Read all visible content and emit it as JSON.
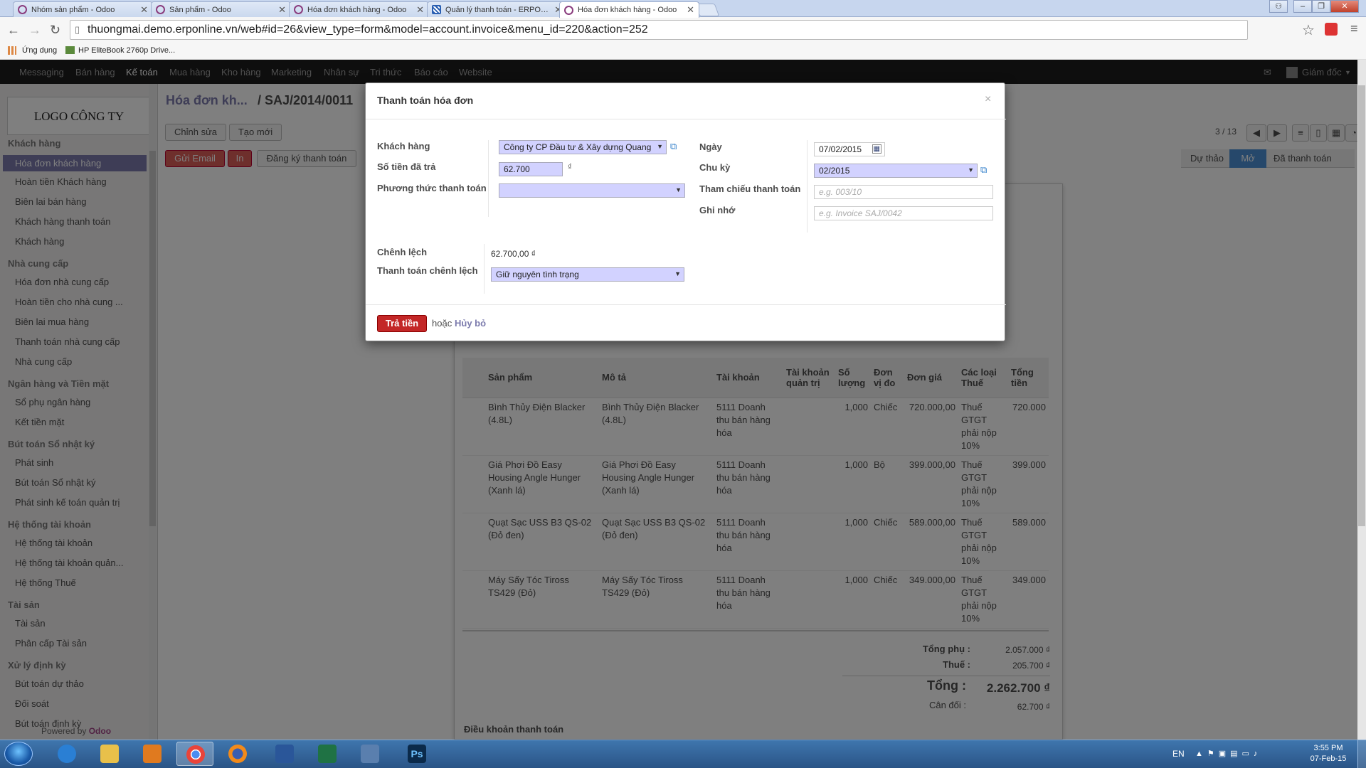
{
  "browser": {
    "tabs": [
      {
        "title": "Nhóm sản phẩm - Odoo",
        "icon": "odoo-icon"
      },
      {
        "title": "Sản phẩm - Odoo",
        "icon": "odoo-icon"
      },
      {
        "title": "Hóa đơn khách hàng - Odoo",
        "icon": "odoo-icon"
      },
      {
        "title": "Quản lý thanh toán - ERPOnlin",
        "icon": "erp-icon"
      },
      {
        "title": "Hóa đơn khách hàng - Odoo",
        "icon": "odoo-icon"
      }
    ],
    "url": "thuongmai.demo.erponline.vn/web#id=26&view_type=form&model=account.invoice&menu_id=220&action=252",
    "bookmarks": [
      "Ứng dụng",
      "HP EliteBook 2760p Drive..."
    ]
  },
  "topnav": {
    "items": [
      "Messaging",
      "Bán hàng",
      "Kế toán",
      "Mua hàng",
      "Kho hàng",
      "Marketing",
      "Nhân sự",
      "Tri thức",
      "Báo cáo",
      "Website"
    ],
    "user": "Giám đốc"
  },
  "sidebar": {
    "logo": "LOGO CÔNG TY",
    "sections": [
      {
        "title": "Khách hàng",
        "items": [
          "Hóa đơn khách hàng",
          "Hoàn tiền Khách hàng",
          "Biên lai bán hàng",
          "Khách hàng thanh toán",
          "Khách hàng"
        ]
      },
      {
        "title": "Nhà cung cấp",
        "items": [
          "Hóa đơn nhà cung cấp",
          "Hoàn tiền cho nhà cung ...",
          "Biên lai mua hàng",
          "Thanh toán nhà cung cấp",
          "Nhà cung cấp"
        ]
      },
      {
        "title": "Ngân hàng và Tiền mặt",
        "items": [
          "Sổ phụ ngân hàng",
          "Kết tiền mặt"
        ]
      },
      {
        "title": "Bút toán Sổ nhật ký",
        "items": [
          "Phát sinh",
          "Bút toán Sổ nhật ký",
          "Phát sinh kế toán quản trị"
        ]
      },
      {
        "title": "Hệ thống tài khoản",
        "items": [
          "Hệ thống tài khoản",
          "Hệ thống tài khoản quản...",
          "Hệ thống Thuế"
        ]
      },
      {
        "title": "Tài sản",
        "items": [
          "Tài sản",
          "Phân cấp Tài sản"
        ]
      },
      {
        "title": "Xử lý định kỳ",
        "items": [
          "Bút toán dự thảo",
          "Đối soát",
          "Bút toán định kỳ"
        ]
      }
    ],
    "powered_prefix": "Powered by",
    "powered_brand": "Odoo"
  },
  "page": {
    "breadcrumb_parent": "Hóa đơn kh...",
    "breadcrumb_current": "/ SAJ/2014/0011",
    "edit": "Chỉnh sửa",
    "create": "Tạo mới",
    "send_email": "Gửi Email",
    "print": "In",
    "register_payment": "Đăng ký thanh toán",
    "pager": "3 / 13",
    "statuses": [
      "Dự thảo",
      "Mở",
      "Đã thanh toán"
    ],
    "table": {
      "headers": [
        "Sản phẩm",
        "Mô tả",
        "Tài khoản",
        "Tài khoản quản trị",
        "Số lượng",
        "Đơn vị đo",
        "Đơn giá",
        "Các loại Thuế",
        "Tổng tiền"
      ],
      "rows": [
        [
          "Bình Thủy Điện Blacker (4.8L)",
          "Bình Thủy Điện Blacker (4.8L)",
          "5111 Doanh thu bán hàng hóa",
          "",
          "1,000",
          "Chiếc",
          "720.000,00",
          "Thuế GTGT phải nộp 10%",
          "720.000"
        ],
        [
          "Giá Phơi Đồ Easy Housing Angle Hunger (Xanh lá)",
          "Giá Phơi Đồ Easy Housing Angle Hunger (Xanh lá)",
          "5111 Doanh thu bán hàng hóa",
          "",
          "1,000",
          "Bộ",
          "399.000,00",
          "Thuế GTGT phải nộp 10%",
          "399.000"
        ],
        [
          "Quạt Sạc USS B3 QS-02 (Đỏ đen)",
          "Quạt Sạc USS B3 QS-02 (Đỏ đen)",
          "5111 Doanh thu bán hàng hóa",
          "",
          "1,000",
          "Chiếc",
          "589.000,00",
          "Thuế GTGT phải nộp 10%",
          "589.000"
        ],
        [
          "Máy Sấy Tóc Tiross TS429 (Đỏ)",
          "Máy Sấy Tóc Tiross TS429 (Đỏ)",
          "5111 Doanh thu bán hàng hóa",
          "",
          "1,000",
          "Chiếc",
          "349.000,00",
          "Thuế GTGT phải nộp 10%",
          "349.000"
        ]
      ]
    },
    "totals": {
      "subtotal_label": "Tổng phụ :",
      "subtotal": "2.057.000 ₫",
      "tax_label": "Thuế :",
      "tax": "205.700 ₫",
      "total_label": "Tổng :",
      "total": "2.262.700 ₫",
      "balance_label": "Cân đối :",
      "balance": "62.700 ₫"
    },
    "payment_terms": "Điều khoản thanh toán"
  },
  "modal": {
    "title": "Thanh toán hóa đơn",
    "customer_label": "Khách hàng",
    "customer_value": "Công ty CP Đầu tư & Xây dựng Quang",
    "amount_label": "Số tiền đã trả",
    "amount_value": "62.700",
    "currency": "₫",
    "method_label": "Phương thức thanh toán",
    "method_value": "",
    "date_label": "Ngày",
    "date_value": "07/02/2015",
    "period_label": "Chu kỳ",
    "period_value": "02/2015",
    "ref_label": "Tham chiếu thanh toán",
    "ref_placeholder": "e.g. 003/10",
    "memo_label": "Ghi nhớ",
    "memo_placeholder": "e.g. Invoice SAJ/0042",
    "diff_label": "Chênh lệch",
    "diff_value": "62.700,00 ₫",
    "writeoff_label": "Thanh toán chênh lệch",
    "writeoff_value": "Giữ nguyên tình trạng",
    "pay_button": "Trả tiền",
    "or_text": "hoặc",
    "cancel": "Hủy bỏ"
  },
  "taskbar": {
    "lang": "EN",
    "time": "3:55 PM",
    "date": "07-Feb-15"
  }
}
